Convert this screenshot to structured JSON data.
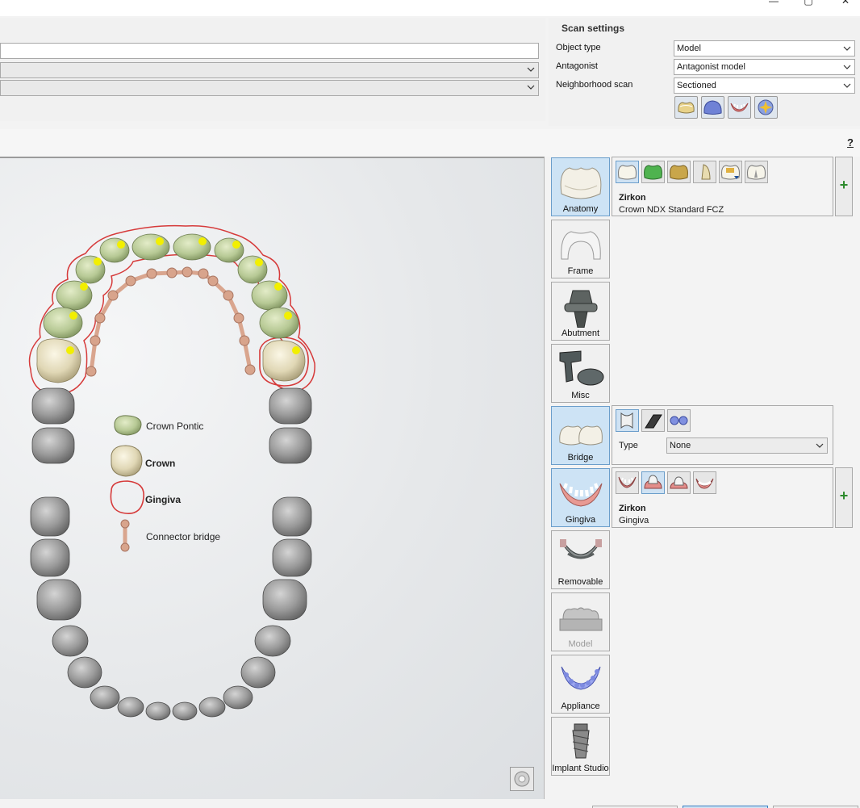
{
  "window": {
    "minimize_glyph": "—",
    "restore_glyph": "▢",
    "close_glyph": "✕"
  },
  "form": {
    "field1_value": "",
    "field2_value": "",
    "field3_value": ""
  },
  "scan_settings": {
    "title": "Scan settings",
    "object_type_label": "Object type",
    "object_type_value": "Model",
    "antagonist_label": "Antagonist",
    "antagonist_value": "Antagonist model",
    "neighborhood_label": "Neighborhood scan",
    "neighborhood_value": "Sectioned",
    "icons": [
      "tooth-scan-icon",
      "model-scan-icon",
      "gingiva-scan-icon",
      "special-scan-icon"
    ]
  },
  "help_label": "?",
  "legend": {
    "crown_pontic": "Crown Pontic",
    "crown": "Crown",
    "gingiva": "Gingiva",
    "connector_bridge": "Connector bridge"
  },
  "tools": {
    "anatomy": "Anatomy",
    "frame": "Frame",
    "abutment": "Abutment",
    "misc": "Misc",
    "bridge": "Bridge",
    "gingiva": "Gingiva",
    "removable": "Removable",
    "model": "Model",
    "appliance": "Appliance",
    "implant_studio": "Implant Studio"
  },
  "anatomy_options": {
    "material": "Zirkon",
    "detail": "Crown NDX Standard FCZ",
    "add": "+"
  },
  "bridge_options": {
    "type_label": "Type",
    "type_value": "None"
  },
  "gingiva_options": {
    "material": "Zirkon",
    "detail": "Gingiva",
    "add": "+"
  },
  "colors": {
    "pontic": "#bccd99",
    "crown": "#e4dcbf",
    "gingiva_outline": "#d63a3a",
    "connector": "#d9a58e",
    "tooth_gray": "#8c8c8c",
    "active_tool": "#cde3f5",
    "marker": "#f2ef00"
  }
}
